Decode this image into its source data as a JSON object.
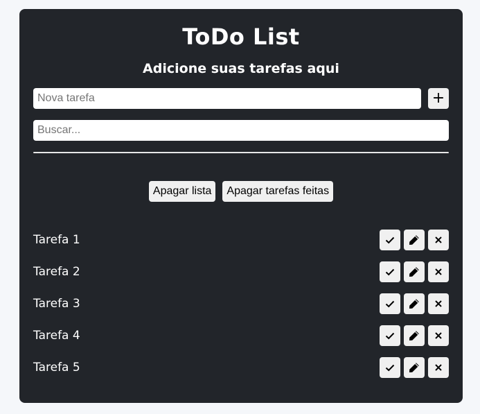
{
  "header": {
    "title": "ToDo List",
    "subtitle": "Adicione suas tarefas aqui"
  },
  "new_task": {
    "placeholder": "Nova tarefa",
    "value": "",
    "add_label": "+"
  },
  "search": {
    "placeholder": "Buscar...",
    "value": ""
  },
  "actions": {
    "clear_list_label": "Apagar lista",
    "clear_done_label": "Apagar tarefas feitas"
  },
  "tasks": [
    {
      "label": "Tarefa 1"
    },
    {
      "label": "Tarefa 2"
    },
    {
      "label": "Tarefa 3"
    },
    {
      "label": "Tarefa 4"
    },
    {
      "label": "Tarefa 5"
    }
  ],
  "task_icons": [
    "check-icon",
    "pencil-icon",
    "close-icon"
  ],
  "colors": {
    "page_bg": "#f5f7fa",
    "card_bg": "#22252a",
    "button_bg": "#f0f0f0",
    "text": "#ffffff"
  }
}
